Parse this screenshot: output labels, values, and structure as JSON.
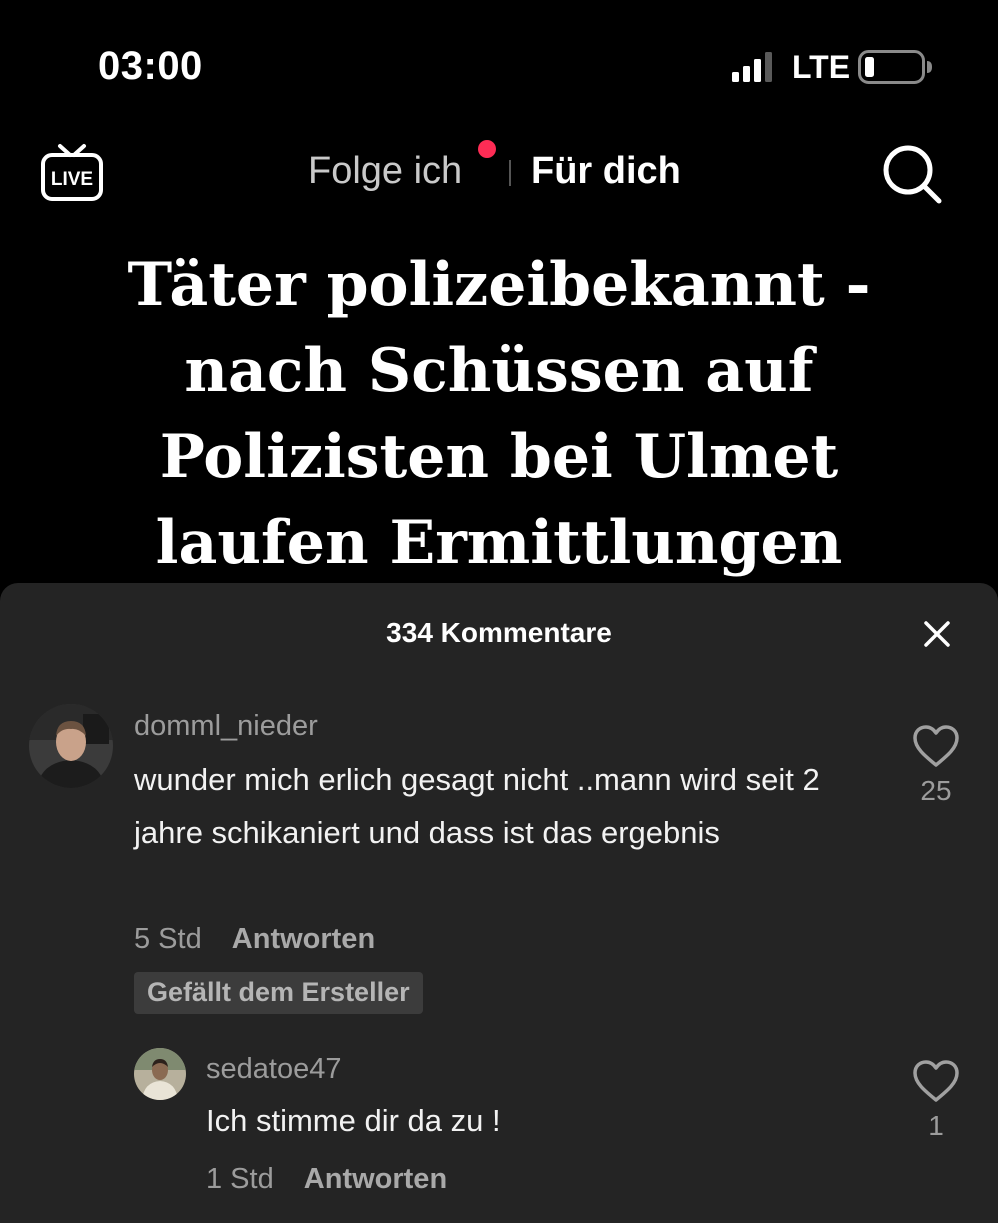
{
  "status_bar": {
    "time": "03:00",
    "network": "LTE"
  },
  "top_nav": {
    "live_label": "LIVE",
    "tab_following": "Folge ich",
    "tab_for_you": "Für dich"
  },
  "video": {
    "headline_lines": [
      "Täter polizeibekannt -",
      "nach Schüssen auf",
      "Polizisten bei Ulmet",
      "laufen Ermittlungen"
    ]
  },
  "comments_sheet": {
    "title": "334 Kommentare",
    "comments": [
      {
        "username": "domml_nieder",
        "text": "wunder mich erlich gesagt nicht ..mann wird seit 2 jahre schikaniert und dass ist das ergebnis",
        "time": "5 Std",
        "reply_label": "Antworten",
        "badge": "Gefällt dem Ersteller",
        "likes": "25"
      },
      {
        "username": "sedatoe47",
        "text": "Ich stimme dir da zu !",
        "time": "1 Std",
        "reply_label": "Antworten",
        "likes": "1"
      }
    ]
  },
  "colors": {
    "background": "#000000",
    "sheet_background": "#242424",
    "notification_dot": "#fe2c55",
    "muted_text": "#9c9c9c"
  }
}
